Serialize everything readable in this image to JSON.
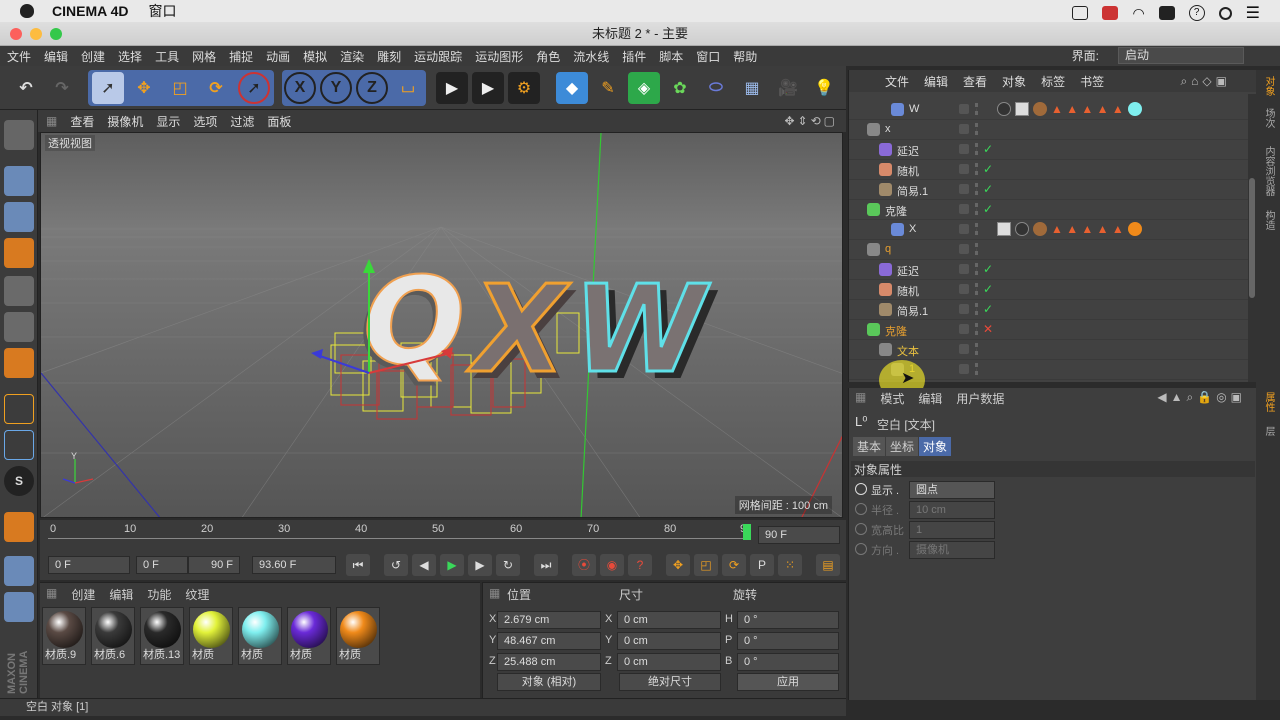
{
  "mac": {
    "app": "CINEMA 4D",
    "menu": "窗口"
  },
  "window": {
    "title": "未标题 2 * - 主要"
  },
  "menu": [
    "文件",
    "编辑",
    "创建",
    "选择",
    "工具",
    "网格",
    "捕捉",
    "动画",
    "模拟",
    "渲染",
    "雕刻",
    "运动跟踪",
    "运动图形",
    "角色",
    "流水线",
    "插件",
    "脚本",
    "窗口",
    "帮助"
  ],
  "layout": {
    "label": "界面:",
    "value": "启动"
  },
  "viewport": {
    "menu": [
      "查看",
      "摄像机",
      "显示",
      "选项",
      "过滤",
      "面板"
    ],
    "label": "透视视图",
    "grid": "网格间距 : 100 cm",
    "text3d": "QXW"
  },
  "timeline": {
    "ticks": [
      "0",
      "10",
      "20",
      "30",
      "40",
      "50",
      "60",
      "70",
      "80",
      "9"
    ],
    "end": "90 F"
  },
  "transport": {
    "current": "0 F",
    "range_start": "0 F",
    "range_end": "90 F",
    "fps": "93.60 F"
  },
  "materials": {
    "menu": [
      "创建",
      "编辑",
      "功能",
      "纹理"
    ],
    "items": [
      {
        "name": "材质.9",
        "color": "#5a4a44"
      },
      {
        "name": "材质.6",
        "color": "#3a3a3a"
      },
      {
        "name": "材质.13",
        "color": "#2a2a2a"
      },
      {
        "name": "材质",
        "color": "#e2f23a"
      },
      {
        "name": "材质",
        "color": "#7fefef"
      },
      {
        "name": "材质",
        "color": "#6a2ad8"
      },
      {
        "name": "材质",
        "color": "#f08a1a"
      }
    ]
  },
  "coords": {
    "headers": [
      "位置",
      "尺寸",
      "旋转"
    ],
    "rows": [
      {
        "a": "X",
        "pos": "2.679 cm",
        "b": "X",
        "size": "0 cm",
        "c": "H",
        "rot": "0 °"
      },
      {
        "a": "Y",
        "pos": "48.467 cm",
        "b": "Y",
        "size": "0 cm",
        "c": "P",
        "rot": "0 °"
      },
      {
        "a": "Z",
        "pos": "25.488 cm",
        "b": "Z",
        "size": "0 cm",
        "c": "B",
        "rot": "0 °"
      }
    ],
    "mode": "对象 (相对)",
    "size_mode": "绝对尺寸",
    "apply": "应用"
  },
  "status": "空白 对象 [1]",
  "objects": {
    "menu": [
      "文件",
      "编辑",
      "查看",
      "对象",
      "标签",
      "书签"
    ],
    "rows": [
      {
        "name": "W",
        "indent": 3,
        "color": "#ddd",
        "icon": "#6a8ad8",
        "state": "none"
      },
      {
        "name": "x",
        "indent": 1,
        "color": "#ddd",
        "icon": "#888",
        "state": "none"
      },
      {
        "name": "延迟",
        "indent": 2,
        "color": "#ddd",
        "icon": "#8a6ad8",
        "state": "check"
      },
      {
        "name": "随机",
        "indent": 2,
        "color": "#ddd",
        "icon": "#d88a6a",
        "state": "check"
      },
      {
        "name": "简易.1",
        "indent": 2,
        "color": "#ddd",
        "icon": "#a08a6a",
        "state": "check"
      },
      {
        "name": "克隆",
        "indent": 1,
        "color": "#ddd",
        "icon": "#5ac85a",
        "state": "check"
      },
      {
        "name": "X",
        "indent": 3,
        "color": "#ddd",
        "icon": "#6a8ad8",
        "state": "none"
      },
      {
        "name": "q",
        "indent": 1,
        "color": "#e8a030",
        "icon": "#888",
        "state": "none"
      },
      {
        "name": "延迟",
        "indent": 2,
        "color": "#ddd",
        "icon": "#8a6ad8",
        "state": "check"
      },
      {
        "name": "随机",
        "indent": 2,
        "color": "#ddd",
        "icon": "#d88a6a",
        "state": "check"
      },
      {
        "name": "简易.1",
        "indent": 2,
        "color": "#ddd",
        "icon": "#a08a6a",
        "state": "check"
      },
      {
        "name": "克隆",
        "indent": 1,
        "color": "#e8a030",
        "icon": "#5ac85a",
        "state": "cross"
      },
      {
        "name": "文本",
        "indent": 2,
        "color": "#e8c040",
        "icon": "#888",
        "state": "none"
      },
      {
        "name": "1",
        "indent": 3,
        "color": "#e8c040",
        "icon": "#888",
        "state": "none"
      }
    ]
  },
  "attributes": {
    "menu": [
      "模式",
      "编辑",
      "用户数据"
    ],
    "title": "空白 [文本]",
    "tabs": [
      "基本",
      "坐标",
      "对象"
    ],
    "section": "对象属性",
    "props": [
      {
        "label": "显示 .",
        "value": "圆点",
        "enabled": true
      },
      {
        "label": "半径 .",
        "value": "10 cm",
        "enabled": false
      },
      {
        "label": "宽高比",
        "value": "1",
        "enabled": false
      },
      {
        "label": "方向 .",
        "value": "摄像机",
        "enabled": false
      }
    ]
  },
  "side_tabs": [
    "对象",
    "场次",
    "内容浏览器",
    "构造"
  ],
  "side_tabs2": [
    "属性",
    "层"
  ],
  "colors": {
    "accent": "#4b6aa8",
    "orange": "#e8a030",
    "cyan": "#5fe0e8"
  }
}
